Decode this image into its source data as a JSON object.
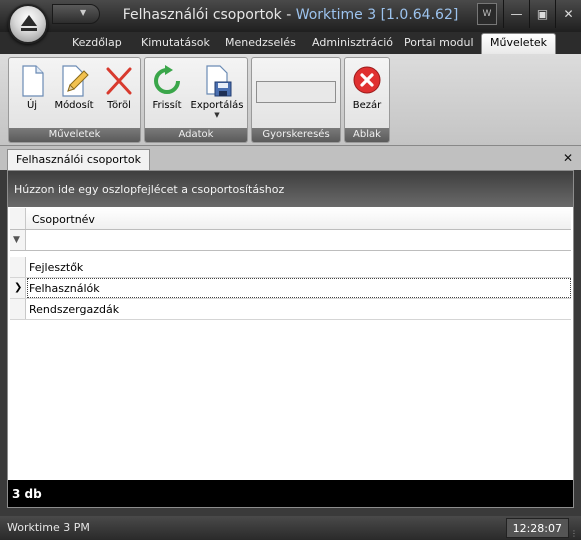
{
  "window": {
    "title_main": "Felhasználói csoportok",
    "title_separator": " - ",
    "title_app": "Worktime 3 [1.0.64.62]",
    "logo_text": "W"
  },
  "tabs": [
    {
      "label": "Kezdőlap"
    },
    {
      "label": "Kimutatások"
    },
    {
      "label": "Menedzselés"
    },
    {
      "label": "Adminisztráció"
    },
    {
      "label": "Portai modul"
    },
    {
      "label": "Műveletek",
      "active": true
    }
  ],
  "ribbon": {
    "groups": [
      {
        "label": "Műveletek",
        "buttons": [
          {
            "label": "Új",
            "icon": "new-document-icon"
          },
          {
            "label": "Módosít",
            "icon": "edit-pencil-icon"
          },
          {
            "label": "Töröl",
            "icon": "delete-x-icon"
          }
        ]
      },
      {
        "label": "Adatok",
        "buttons": [
          {
            "label": "Frissít",
            "icon": "refresh-icon"
          },
          {
            "label": "Exportálás",
            "icon": "export-save-icon",
            "has_dropdown": true
          }
        ]
      },
      {
        "label": "Gyorskeresés"
      },
      {
        "label": "Ablak",
        "buttons": [
          {
            "label": "Bezár",
            "icon": "close-circle-icon"
          }
        ]
      }
    ]
  },
  "document": {
    "tab_label": "Felhasználói csoportok",
    "group_panel_text": "Húzzon ide egy oszlopfejlécet a csoportosításhoz",
    "grid": {
      "column_header": "Csoportnév",
      "rows": [
        {
          "name": "Fejlesztők"
        },
        {
          "name": "Felhasználók",
          "selected": true
        },
        {
          "name": "Rendszergazdák"
        }
      ]
    },
    "summary": "3 db"
  },
  "statusbar": {
    "left_text": "Worktime 3 PM",
    "clock": "12:28:07"
  },
  "colors": {
    "chrome_dark": "#2c2c2c",
    "title_accent": "#9cc3ee",
    "delete_red": "#d83a2e",
    "refresh_green": "#3aa64a",
    "close_red": "#e03131"
  }
}
